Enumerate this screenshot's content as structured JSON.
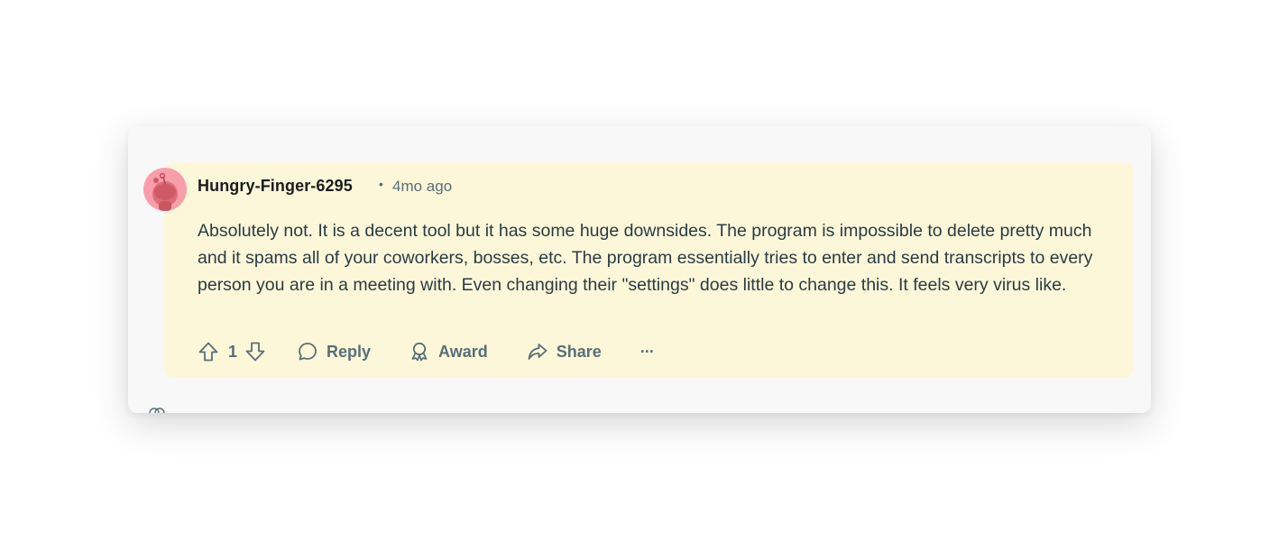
{
  "comment": {
    "author": "Hungry-Finger-6295",
    "separator": "•",
    "timestamp": "4mo ago",
    "body": "Absolutely not. It is a decent tool but it has some huge downsides. The program is impossible to delete pretty much and it spams all of your coworkers, bosses, etc. The program essentially tries to enter and send transcripts to every person you are in a meeting with. Even changing their \"settings\" does little to change this. It feels very virus like.",
    "avatar_icon": "reddit-snoo-avatar",
    "highlight_color": "#fdf7da",
    "avatar_color": "#f89eab"
  },
  "actions": {
    "upvote_icon": "upvote-arrow-icon",
    "vote_count": "1",
    "downvote_icon": "downvote-arrow-icon",
    "reply_label": "Reply",
    "award_label": "Award",
    "share_label": "Share",
    "more_label": "···"
  }
}
